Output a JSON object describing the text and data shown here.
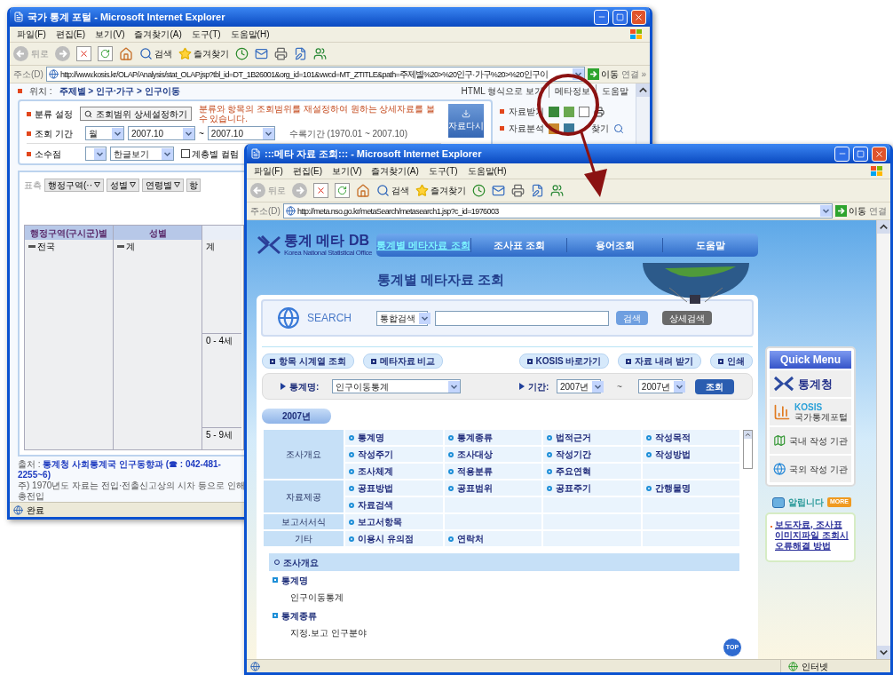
{
  "back_window": {
    "title": "국가 통계 포털 - Microsoft Internet Explorer",
    "menu": [
      "파일(F)",
      "편집(E)",
      "보기(V)",
      "즐겨찾기(A)",
      "도구(T)",
      "도움말(H)"
    ],
    "toolbar": {
      "back": "뒤로",
      "search": "검색",
      "favorites": "즐겨찾기"
    },
    "address": {
      "label": "주소(D)",
      "url": "http://www.kosis.kr/OLAP/Analysis/stat_OLAP.jsp?tbl_id=DT_1B26001&org_id=101&vwcd=MT_ZTITLE&path=주제별%20>%20인구·가구%20>%20인구이",
      "go": "이동",
      "links": "연결 »"
    },
    "breadcrumb": {
      "label": "위치 :",
      "path": "주제별 > 인구·가구 > 인구이동"
    },
    "top_links": [
      "HTML 형식으로 보기",
      "메타정보",
      "도움말"
    ],
    "classify": {
      "label": "분류 설정",
      "button": "조회범위 상세설정하기",
      "note": "분류와 항목의 조회범위를 재설정하여 원하는 상세자료를 볼수 있습니다."
    },
    "period": {
      "label": "조회 기간",
      "unit": "월",
      "from": "2007.10",
      "tilde": "~",
      "to": "2007.10",
      "range": "수록기간 (1970.01 ~ 2007.10)"
    },
    "decimal": {
      "label": "소수점",
      "lang": "한글보기",
      "checkbox": {
        "label": "계층별 컬럼",
        "checked": false
      }
    },
    "reload_button": "자료다시",
    "side_tools": [
      "자료받기",
      "자료분석"
    ],
    "find": "찾기",
    "pivot": {
      "label": "표측",
      "fields": [
        "행정구역(··",
        "성별",
        "연령별"
      ],
      "cut": "항"
    },
    "table": {
      "columns": [
        "행정구역(구시군)별",
        "성별"
      ],
      "region": "전국",
      "sex": "계",
      "ages": [
        "계",
        "0 - 4세",
        "5 - 9세"
      ]
    },
    "footer": {
      "source_label": "출처 :",
      "source": "통계청 사회통계국 인구동향과 (☎ : 042-481-2255~6)",
      "note": "주) 1970년도 자료는 전입·전출신고상의 시차 등으로 인해 총전입"
    },
    "status": "완료"
  },
  "front_window": {
    "title": ":::메타 자료 조회::: - Microsoft Internet Explorer",
    "menu": [
      "파일(F)",
      "편집(E)",
      "보기(V)",
      "즐겨찾기(A)",
      "도구(T)",
      "도움말(H)"
    ],
    "toolbar": {
      "back": "뒤로",
      "search": "검색",
      "favorites": "즐겨찾기"
    },
    "address": {
      "label": "주소(D)",
      "url": "http://meta.nso.go.kr/metaSearch/metasearch1.jsp?c_id=1976003",
      "go": "이동",
      "links": "연결"
    },
    "logo": {
      "name": "통계 메타 DB",
      "subtitle": "Korea National Statistical Office"
    },
    "nav": [
      {
        "label": "통계별 메타자료 조회",
        "selected": true
      },
      {
        "label": "조사표 조회",
        "selected": false
      },
      {
        "label": "용어조회",
        "selected": false
      },
      {
        "label": "도움말",
        "selected": false
      }
    ],
    "heading": "통계별 메타자료 조회",
    "search": {
      "label": "SEARCH",
      "scope": "통합검색",
      "button": "검색",
      "advanced": "상세검색"
    },
    "actions_left": [
      "항목 시계열 조회",
      "메타자료 비교"
    ],
    "actions_right": [
      "KOSIS 바로가기",
      "자료 내려 받기",
      "인쇄"
    ],
    "filter": {
      "stat_label": "통계명:",
      "stat": "인구이동통계",
      "period_label": "기간:",
      "from": "2007년",
      "tilde": "~",
      "to": "2007년",
      "button": "조회"
    },
    "year_tab": "2007년",
    "categories": [
      {
        "name": "조사개요",
        "items": [
          "통계명",
          "통계종류",
          "법적근거",
          "작성목적",
          "작성주기",
          "조사대상",
          "작성기간",
          "작성방법",
          "조사체계",
          "적용분류",
          "주요연혁"
        ]
      },
      {
        "name": "자료제공",
        "items": [
          "공표방법",
          "공표범위",
          "공표주기",
          "간행물명",
          "자료검색"
        ]
      },
      {
        "name": "보고서서식",
        "items": [
          "보고서항목"
        ]
      },
      {
        "name": "기타",
        "items": [
          "이용시 유의점",
          "연락처"
        ]
      }
    ],
    "detail": {
      "section": "조사개요",
      "entries": [
        {
          "title": "통계명",
          "value": "인구이동통계"
        },
        {
          "title": "통계종류",
          "value": "지정.보고 인구분야"
        }
      ]
    },
    "top": "TOP",
    "quick_menu": {
      "title": "Quick Menu",
      "items": [
        {
          "kind": "agency",
          "label": "통계청"
        },
        {
          "kind": "portal",
          "label": "KOSIS",
          "sub": "국가통계포털"
        },
        {
          "kind": "domestic",
          "label": "국내 작성 기관"
        },
        {
          "kind": "foreign",
          "label": "국외 작성 기관"
        }
      ]
    },
    "notice": {
      "title": "알립니다",
      "badge": "MORE",
      "link": "보도자료, 조사표이미지파일 조회시 오류해결 방법"
    },
    "status": "인터넷"
  }
}
